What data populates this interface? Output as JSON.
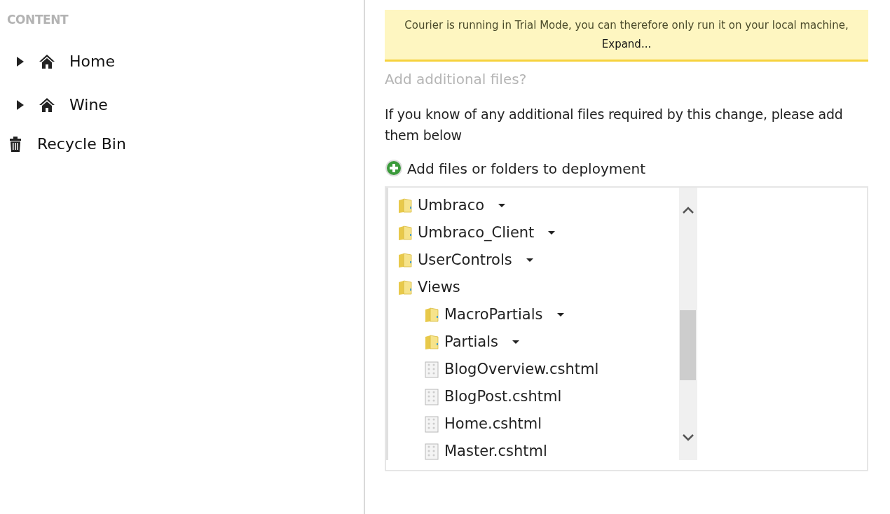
{
  "sidebar": {
    "heading": "CONTENT",
    "items": [
      {
        "kind": "node",
        "label": "Home"
      },
      {
        "kind": "node",
        "label": "Wine"
      },
      {
        "kind": "recycle",
        "label": "Recycle Bin"
      }
    ]
  },
  "notice": {
    "text": "Courier is running in Trial Mode, you can therefore only run it on your local machine,",
    "link": "Expand..."
  },
  "section_title": "Add additional files?",
  "description": "If you know of any additional files required by this change, please add them below",
  "add_link": "Add files or folders to deployment",
  "tree": [
    {
      "kind": "folder",
      "label": "Umbraco",
      "expanded": false
    },
    {
      "kind": "folder",
      "label": "Umbraco_Client",
      "expanded": false
    },
    {
      "kind": "folder",
      "label": "UserControls",
      "expanded": false
    },
    {
      "kind": "folder",
      "label": "Views",
      "expanded": true,
      "children": [
        {
          "kind": "folder",
          "label": "MacroPartials",
          "expanded": false
        },
        {
          "kind": "folder",
          "label": "Partials",
          "expanded": false
        },
        {
          "kind": "file",
          "label": "BlogOverview.cshtml"
        },
        {
          "kind": "file",
          "label": "BlogPost.cshtml"
        },
        {
          "kind": "file",
          "label": "Home.cshtml"
        },
        {
          "kind": "file",
          "label": "Master.cshtml"
        }
      ]
    }
  ]
}
